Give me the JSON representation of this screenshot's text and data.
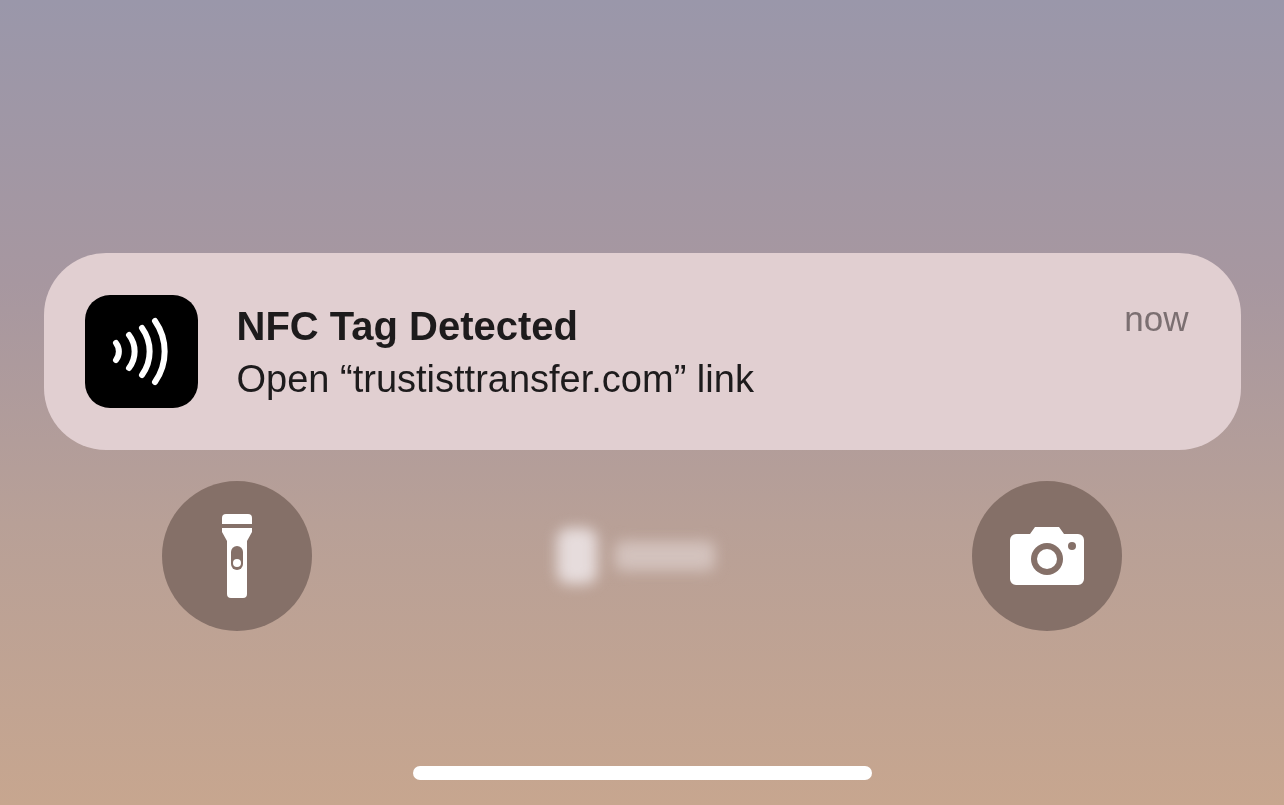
{
  "notification": {
    "title": "NFC Tag Detected",
    "body": "Open “trustisttransfer.com” link",
    "time": "now"
  },
  "quick_actions": [
    {
      "kind": "flashlight"
    },
    {
      "kind": "camera"
    }
  ]
}
